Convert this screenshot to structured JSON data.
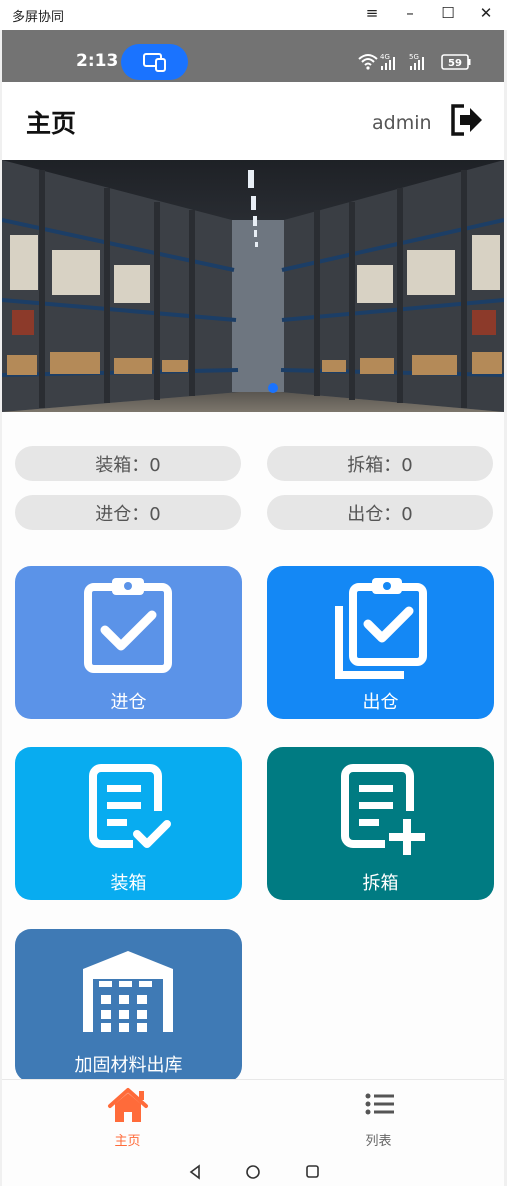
{
  "window": {
    "title": "多屏协同",
    "controls": {
      "menu": "≡",
      "minimize": "–",
      "maximize": "☐",
      "close": "✕"
    }
  },
  "status_bar": {
    "time": "2:13",
    "network_4g": "4G",
    "network_5g": "5G",
    "battery": "59"
  },
  "header": {
    "title": "主页",
    "username": "admin"
  },
  "banner": {
    "carousel_dots": 1,
    "active_dot_color": "#1a73ff"
  },
  "stats": [
    {
      "label": "装箱：0"
    },
    {
      "label": "拆箱：0"
    },
    {
      "label": "进仓：0"
    },
    {
      "label": "出仓：0"
    }
  ],
  "tiles": [
    {
      "label": "进仓",
      "icon": "clipboard-check-icon",
      "color": "#5b93e8"
    },
    {
      "label": "出仓",
      "icon": "clipboard-copy-check-icon",
      "color": "#1488f5"
    },
    {
      "label": "装箱",
      "icon": "document-check-icon",
      "color": "#08acf0"
    },
    {
      "label": "拆箱",
      "icon": "document-plus-icon",
      "color": "#007b82"
    },
    {
      "label": "加固材料出库",
      "icon": "warehouse-icon",
      "color": "#3f7ab5"
    }
  ],
  "bottom_nav": [
    {
      "label": "主页",
      "icon": "home-icon",
      "active": true,
      "color": "#ff6b3a"
    },
    {
      "label": "列表",
      "icon": "list-icon",
      "active": false,
      "color": "#666666"
    }
  ]
}
